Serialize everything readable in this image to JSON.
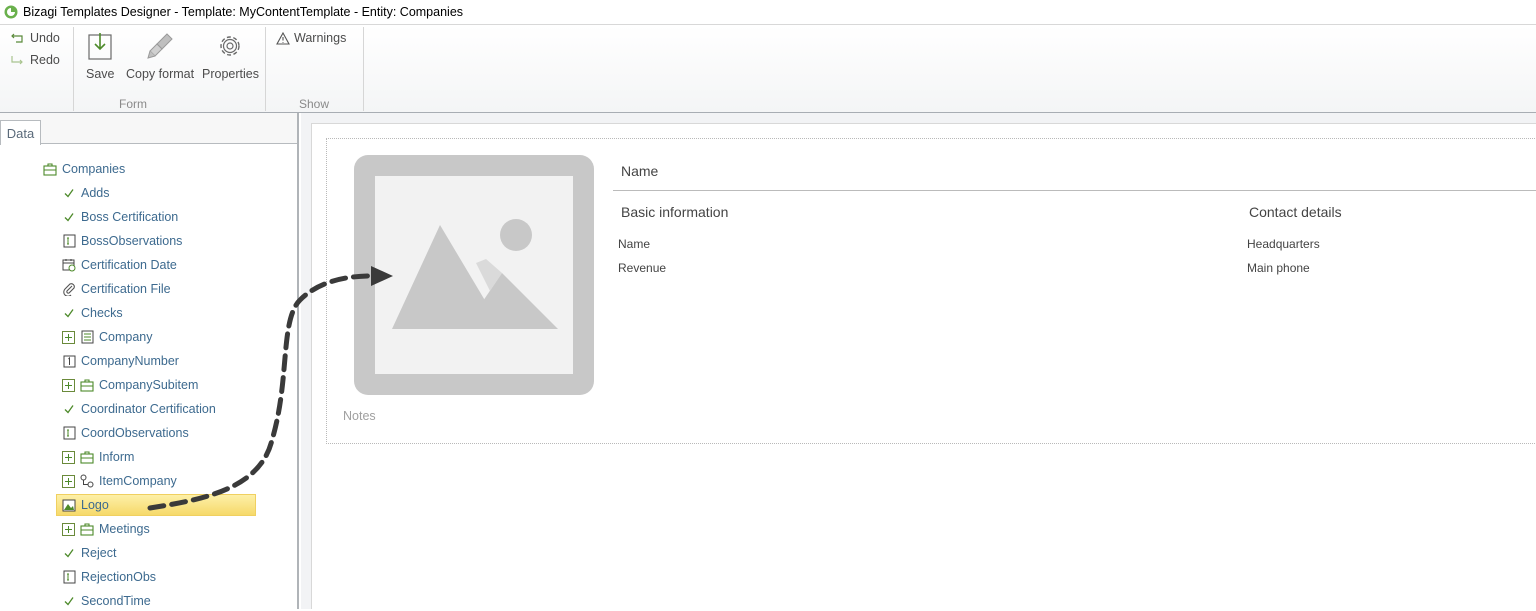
{
  "window": {
    "title": "Bizagi Templates Designer  - Template: MyContentTemplate - Entity:  Companies"
  },
  "ribbon": {
    "undo": "Undo",
    "redo": "Redo",
    "save": "Save",
    "copy_format": "Copy format",
    "properties": "Properties",
    "warnings": "Warnings",
    "group_form": "Form",
    "group_show": "Show"
  },
  "left_panel": {
    "tab": "Data",
    "root": "Companies",
    "items": [
      {
        "label": "Adds",
        "icon": "check-icon"
      },
      {
        "label": "Boss Certification",
        "icon": "check-icon"
      },
      {
        "label": "BossObservations",
        "icon": "text-field-icon"
      },
      {
        "label": "Certification Date",
        "icon": "calendar-icon"
      },
      {
        "label": "Certification File",
        "icon": "paperclip-icon"
      },
      {
        "label": "Checks",
        "icon": "check-icon"
      },
      {
        "label": "Company",
        "icon": "form-icon"
      },
      {
        "label": "CompanyNumber",
        "icon": "number-icon"
      },
      {
        "label": "CompanySubitem",
        "icon": "entity-icon"
      },
      {
        "label": "Coordinator Certification",
        "icon": "check-icon"
      },
      {
        "label": "CoordObservations",
        "icon": "text-field-icon"
      },
      {
        "label": "Inform",
        "icon": "entity-icon"
      },
      {
        "label": "ItemCompany",
        "icon": "relation-icon"
      },
      {
        "label": "Logo",
        "icon": "image-icon"
      },
      {
        "label": "Meetings",
        "icon": "entity-icon"
      },
      {
        "label": "Reject",
        "icon": "check-icon"
      },
      {
        "label": "RejectionObs",
        "icon": "text-field-icon"
      },
      {
        "label": "SecondTime",
        "icon": "check-icon"
      }
    ]
  },
  "form": {
    "name_title": "Name",
    "basic_info": "Basic information",
    "contact_details": "Contact details",
    "field_name": "Name",
    "field_revenue": "Revenue",
    "field_headquarters": "Headquarters",
    "field_main_phone": "Main phone",
    "notes": "Notes"
  },
  "colors": {
    "accent_green": "#4d8a2a",
    "tree_text": "#3d6a8f",
    "selection": "#f6d96a",
    "placeholder_gray": "#c8c8c8"
  }
}
